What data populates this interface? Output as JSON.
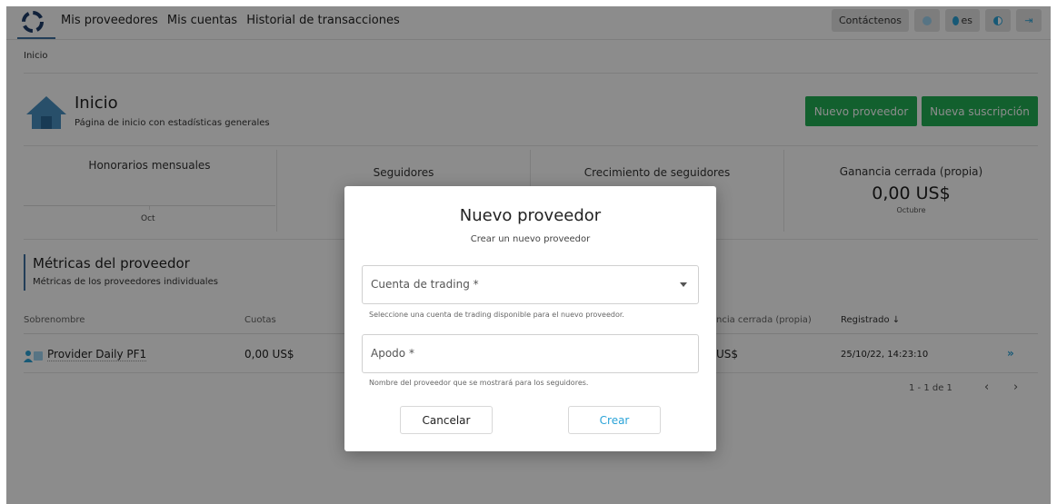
{
  "nav": {
    "links": [
      "Mis proveedores",
      "Mis cuentas",
      "Historial de transacciones"
    ],
    "contact": "Contáctenos",
    "lang": "es",
    "icons": [
      "settings-icon",
      "globe-icon",
      "theme-toggle-icon",
      "logout-icon"
    ]
  },
  "breadcrumb": "Inicio",
  "page": {
    "title": "Inicio",
    "subtitle": "Página de inicio con estadísticas generales"
  },
  "actions": {
    "new_provider": "Nuevo proveedor",
    "new_subscription": "Nueva suscripción"
  },
  "stats": [
    {
      "label": "Honorarios mensuales",
      "chart_label": "Oct"
    },
    {
      "label": "Seguidores"
    },
    {
      "label": "Crecimiento de seguidores"
    },
    {
      "label": "Ganancia cerrada (propia)",
      "value": "0,00 US$",
      "period": "Octubre"
    }
  ],
  "metrics": {
    "title": "Métricas del proveedor",
    "subtitle": "Métricas de los proveedores individuales"
  },
  "table": {
    "headers": {
      "nickname": "Sobrenombre",
      "fees": "Cuotas",
      "profit": "ncia cerrada (propia)",
      "registered": "Registrado ↓"
    },
    "rows": [
      {
        "nickname": "Provider Daily PF1",
        "fees": "0,00 US$",
        "profit": "US$",
        "registered": "25/10/22, 14:23:10"
      }
    ],
    "pagination": "1 - 1 de 1"
  },
  "modal": {
    "title": "Nuevo proveedor",
    "subtitle": "Crear un nuevo proveedor",
    "account_label": "Cuenta de trading *",
    "account_hint": "Seleccione una cuenta de trading disponible para el nuevo proveedor.",
    "alias_label": "Apodo *",
    "alias_hint": "Nombre del proveedor que se mostrará para los seguidores.",
    "cancel": "Cancelar",
    "create": "Crear"
  },
  "colors": {
    "green": "#21b055",
    "accent": "#2aa3d8",
    "nav_blue": "#3f6fa0"
  }
}
